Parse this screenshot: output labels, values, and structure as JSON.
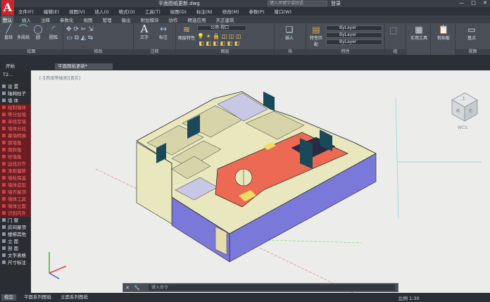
{
  "titlebar": {
    "app_letter": "A",
    "title": "平面图纸更新.dwg",
    "search_placeholder": "键入关键字或短语",
    "user": "登录",
    "minimize": "—",
    "maximize": "□",
    "close": "✕"
  },
  "menu": [
    "文件(F)",
    "编辑(E)",
    "视图(V)",
    "插入(I)",
    "格式(O)",
    "工具(T)",
    "绘图(D)",
    "标注(N)",
    "修改(M)",
    "参数(P)",
    "窗口(W)"
  ],
  "ribbon_tabs": [
    "默认",
    "插入",
    "注释",
    "参数化",
    "视图",
    "管理",
    "输出",
    "附加模块",
    "协作",
    "精选应用",
    "天正建筑"
  ],
  "ribbon": {
    "draw": {
      "label": "绘图",
      "tools": [
        "直线",
        "多段线",
        "圆",
        "圆弧"
      ]
    },
    "modify": {
      "label": "修改"
    },
    "annotation": {
      "label": "注释",
      "tools": [
        "文字",
        "标注"
      ]
    },
    "layers": {
      "label": "图层",
      "tool": "图层特性",
      "layer_name": "公用-视口"
    },
    "block": {
      "label": "块",
      "tool": "插入"
    },
    "properties": {
      "label": "特性",
      "tool": "特性匹配",
      "color": "ByLayer",
      "linetype": "ByLayer",
      "lineweight": "ByLayer"
    },
    "groups": {
      "label": "组"
    },
    "utilities": {
      "label": "实用工具"
    },
    "clipboard": {
      "label": "剪贴板"
    },
    "view": {
      "label": "视图",
      "tool": "基点"
    }
  },
  "doc_tabs": [
    "开始",
    "平面图纸更新*"
  ],
  "palette": {
    "header": "T2...",
    "items_top": [
      "设 置",
      "轴网柱子",
      "墙 体"
    ],
    "items_red": [
      "绘制墙体",
      "等分加墙",
      "单线变墙",
      "墙体分段",
      "幕墙转换",
      "倒墙角",
      "倒斜角",
      "修墙角",
      "边线对齐",
      "净距偏移",
      "墙柱保温",
      "墙体造型",
      "墙齐屋顶",
      "墙体工具",
      "墙体立面",
      "识别内外"
    ],
    "items_bottom": [
      "门 窗",
      "房间屋顶",
      "楼梯其他",
      "立 面",
      "剖 面",
      "文字表格",
      "尺寸标注"
    ]
  },
  "viewport": {
    "label": "[-][西南等轴测][真实]",
    "wcs": "WCS",
    "viewcube_faces": [
      "上",
      "前",
      "右"
    ]
  },
  "command": {
    "placeholder": "键入命令",
    "icons": [
      "✕",
      "🔧"
    ]
  },
  "status": {
    "tabs": [
      "模型",
      "平面系列图纸",
      "立面系列图纸"
    ],
    "scale": "比例 1:30"
  },
  "colors": {
    "floor_slab": "#ec6a54",
    "wall_tops": "#e8e7bd",
    "walls_outer": "#7a78d8",
    "windows": "#1a4a5a"
  }
}
